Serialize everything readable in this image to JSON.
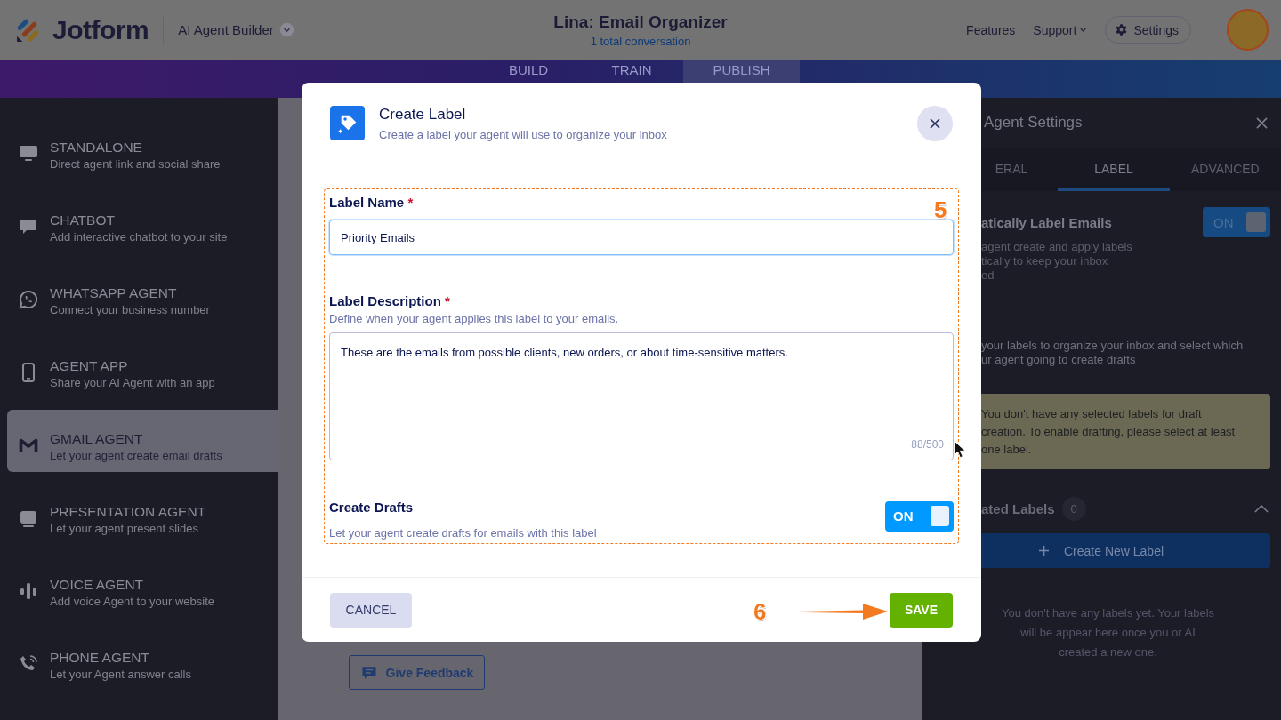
{
  "header": {
    "logo": "Jotform",
    "product": "AI Agent Builder",
    "title": "Lina: Email Organizer",
    "subtitle": "1 total conversation",
    "links": [
      "Features",
      "Support"
    ],
    "settings": "Settings"
  },
  "tabs": [
    {
      "label": "BUILD",
      "selected": false
    },
    {
      "label": "TRAIN",
      "selected": false
    },
    {
      "label": "PUBLISH",
      "selected": true
    }
  ],
  "sidebar": {
    "items": [
      {
        "title": "STANDALONE",
        "subtitle": "Direct agent link and social share",
        "selected": false
      },
      {
        "title": "CHATBOT",
        "subtitle": "Add interactive chatbot to your site",
        "selected": false
      },
      {
        "title": "WHATSAPP AGENT",
        "subtitle": "Connect your business number",
        "selected": false
      },
      {
        "title": "AGENT APP",
        "subtitle": "Share your AI Agent with an app",
        "selected": false
      },
      {
        "title": "GMAIL AGENT",
        "subtitle": "Let your agent create email drafts",
        "selected": true
      },
      {
        "title": "PRESENTATION AGENT",
        "subtitle": "Let your agent present slides",
        "selected": false
      },
      {
        "title": "VOICE AGENT",
        "subtitle": "Add voice Agent to your website",
        "selected": false
      },
      {
        "title": "PHONE AGENT",
        "subtitle": "Let your Agent answer calls",
        "selected": false
      }
    ]
  },
  "feedback_button": "Give Feedback",
  "panel": {
    "title": "Agent Settings",
    "tabs": [
      {
        "label": "ERAL",
        "selected": false
      },
      {
        "label": "LABEL",
        "selected": true
      },
      {
        "label": "ADVANCED",
        "selected": false
      }
    ],
    "auto_label": {
      "title": "atically Label Emails",
      "toggle": {
        "text": "ON",
        "on": true
      },
      "description": [
        "agent create and apply labels",
        "tically to keep your inbox",
        "ed"
      ]
    },
    "labels_intro": [
      "your labels to organize your inbox and select which",
      "ur agent going to create drafts"
    ],
    "warning": [
      "You don't have any selected labels for draft",
      "creation. To enable drafting, please select at least",
      "one label."
    ],
    "created": {
      "title": "ated Labels",
      "count": "0",
      "expanded": true
    },
    "create_button": "Create New Label",
    "empty": [
      "You don't have any labels yet. Your labels",
      "will be appear here once you or AI",
      "created a new one."
    ]
  },
  "dialog": {
    "title": "Create Label",
    "subtitle": "Create a label your agent will use to organize your inbox",
    "fields": [
      {
        "kind": "input",
        "label": "Label Name",
        "required": "*",
        "value": "Priority Emails"
      },
      {
        "kind": "textarea",
        "label": "Label Description",
        "required": "*",
        "hint": "Define when your agent applies this label to your emails.",
        "value": "These are the emails from possible clients, new orders, or about time-sensitive matters.",
        "counter": "88/500"
      }
    ],
    "drafts": {
      "label": "Create Drafts",
      "hint": "Let your agent create drafts for emails with this label",
      "toggle": {
        "text": "ON",
        "on": true
      }
    },
    "cancel": "CANCEL",
    "save": "SAVE"
  },
  "annotations": [
    {
      "text": "5"
    },
    {
      "text": "6"
    }
  ]
}
